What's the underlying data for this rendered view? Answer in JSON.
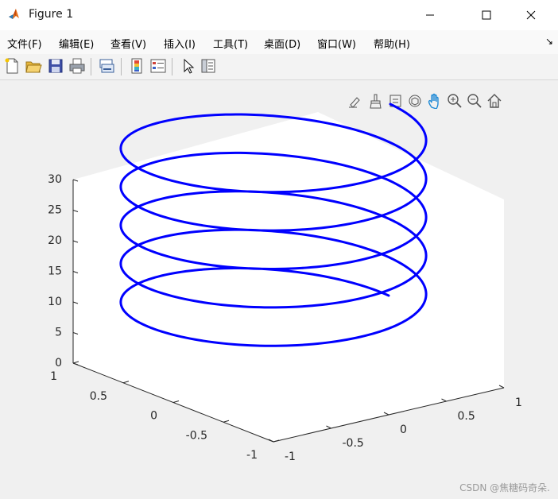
{
  "window": {
    "title": "Figure 1",
    "minimize_icon": "minimize-icon",
    "maximize_icon": "maximize-icon",
    "close_icon": "close-icon"
  },
  "menu": {
    "items": [
      "文件(F)",
      "编辑(E)",
      "查看(V)",
      "插入(I)",
      "工具(T)",
      "桌面(D)",
      "窗口(W)",
      "帮助(H)"
    ],
    "overflow_icon": "dock-arrow-icon"
  },
  "toolbar": {
    "buttons": [
      "new-figure-icon",
      "open-file-icon",
      "save-icon",
      "print-icon",
      "link-plot-icon",
      "colorbar-icon",
      "legend-icon",
      "pointer-icon",
      "property-inspector-icon"
    ]
  },
  "axes_toolbar": {
    "buttons": [
      "brush-icon",
      "brush-data-icon",
      "data-tips-icon",
      "rotate-3d-icon",
      "pan-icon",
      "zoom-in-icon",
      "zoom-out-icon",
      "home-icon"
    ]
  },
  "chart_data": {
    "type": "line",
    "plot3": true,
    "description_of_curve": "helix x=cos(t), y=sin(t), z=t",
    "series": [
      {
        "color": "#0000ff",
        "t_start": 0,
        "t_end": 31.4,
        "line_width": "thick"
      }
    ],
    "xlim": [
      -1,
      1
    ],
    "ylim": [
      -1,
      1
    ],
    "zlim": [
      0,
      30
    ],
    "xticks": [
      "-1",
      "-0.5",
      "0",
      "0.5",
      "1"
    ],
    "yticks": [
      "-1",
      "-0.5",
      "0",
      "0.5",
      "1"
    ],
    "zticks": [
      "0",
      "5",
      "10",
      "15",
      "20",
      "25",
      "30"
    ],
    "grid": false,
    "box": false
  },
  "watermark": "CSDN @焦糖码奇朵."
}
